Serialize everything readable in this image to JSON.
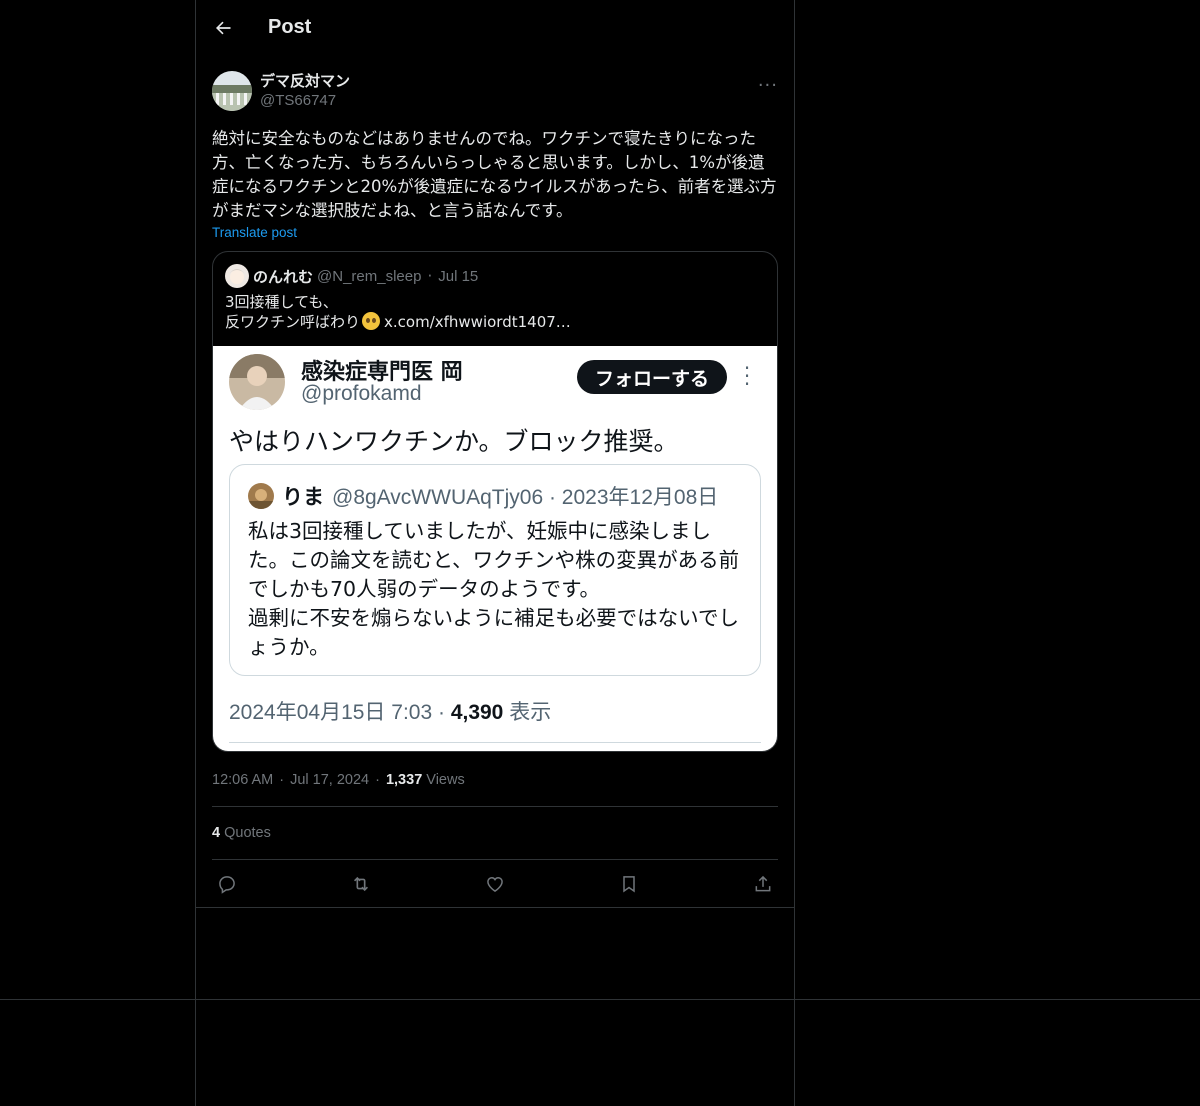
{
  "header": {
    "title": "Post"
  },
  "post": {
    "display_name": "デマ反対マン",
    "handle": "@TS66747",
    "text": "絶対に安全なものなどはありませんのでね。ワクチンで寝たきりになった方、亡くなった方、もちろんいらっしゃると思います。しかし、1%が後遺症になるワクチンと20%が後遺症になるウイルスがあったら、前者を選ぶ方がまだマシな選択肢だよね、と言う話なんです。",
    "translate_label": "Translate post",
    "time": "12:06 AM",
    "date": "Jul 17, 2024",
    "views_count": "1,337",
    "views_label": "Views",
    "quotes_count": "4",
    "quotes_label": "Quotes"
  },
  "quoted": {
    "display_name": "のんれむ",
    "handle": "@N_rem_sleep",
    "date": "Jul 15",
    "line1": "3回接種しても、",
    "line2": "反ワクチン呼ばわり",
    "link": "x.com/xfhwwiordt1407…"
  },
  "screenshot": {
    "name": "感染症専門医 岡",
    "handle": "@profokamd",
    "follow_label": "フォローする",
    "main_text": "やはりハンワクチンか。ブロック推奨。",
    "inner_name": "りま",
    "inner_meta": "@8gAvcWWUAqTjy06 · 2023年12月08日",
    "inner_text": "私は3回接種していましたが、妊娠中に感染しました。この論文を読むと、ワクチンや株の変異がある前でしかも70人弱のデータのようです。\n過剰に不安を煽らないように補足も必要ではないでしょうか。",
    "foot_date": "2024年04月15日 7:03 · ",
    "foot_views": "4,390",
    "foot_label": " 表示"
  },
  "icons": [
    "back-arrow-icon",
    "more-icon",
    "reply-icon",
    "retweet-icon",
    "like-icon",
    "bookmark-icon",
    "share-icon"
  ]
}
